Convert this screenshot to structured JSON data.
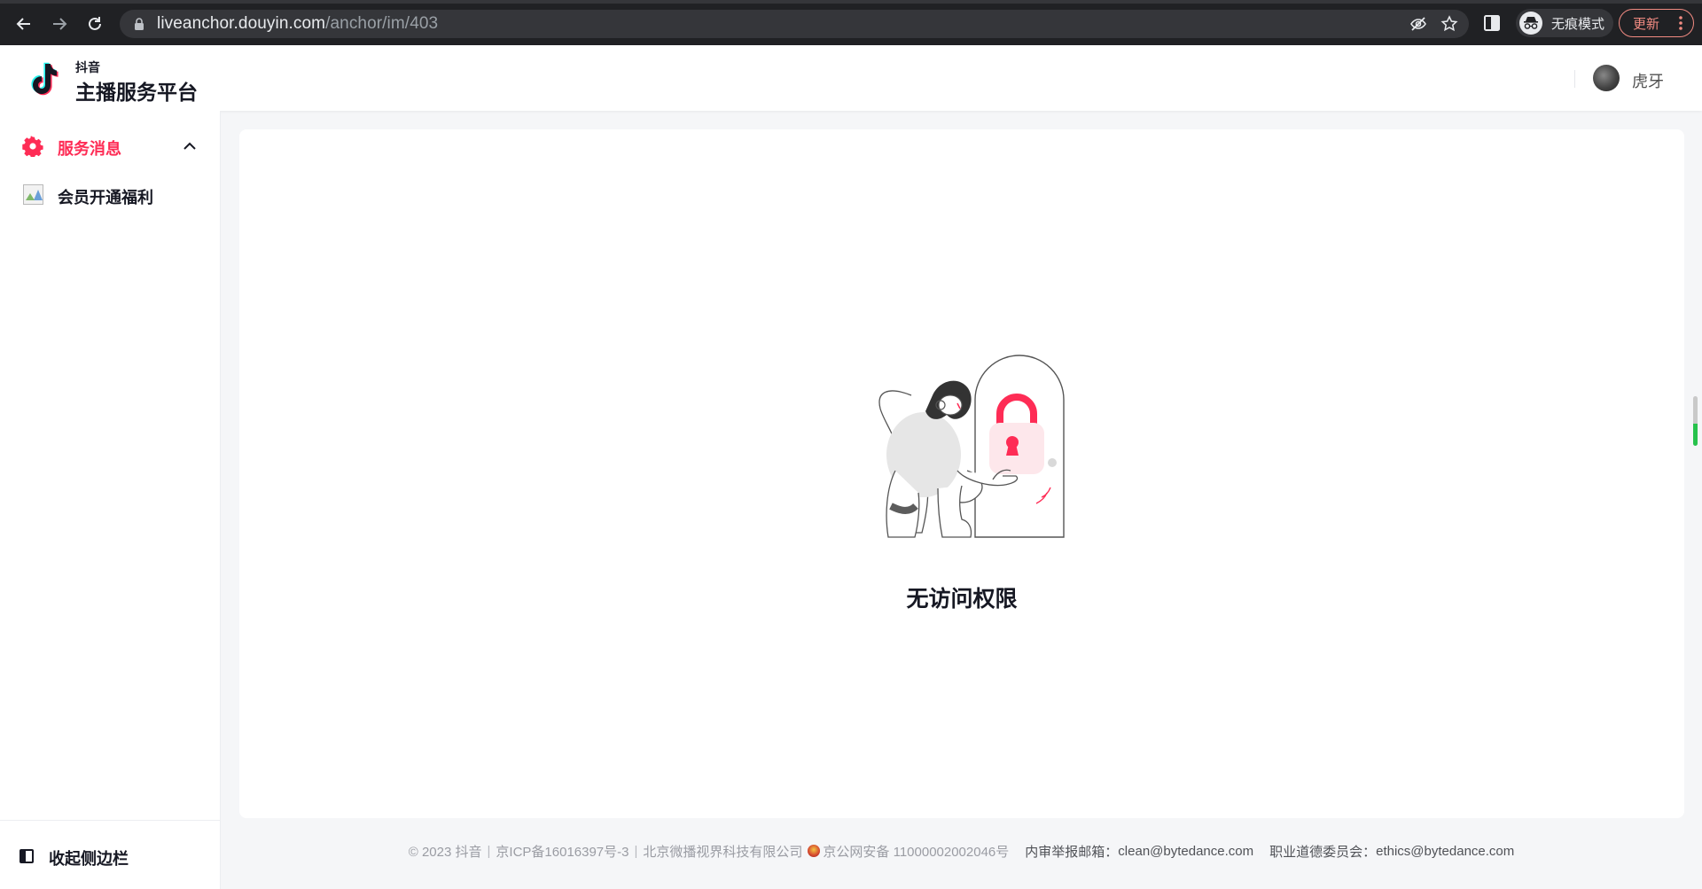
{
  "browser": {
    "url_host": "liveanchor.douyin.com",
    "url_path": "/anchor/im/403",
    "incognito_label": "无痕模式",
    "update_label": "更新"
  },
  "header": {
    "brand_small": "抖音",
    "brand_large": "主播服务平台",
    "username": "虎牙"
  },
  "sidebar": {
    "group_label": "服务消息",
    "items": [
      {
        "label": "会员开通福利"
      }
    ],
    "collapse_label": "收起侧边栏"
  },
  "main": {
    "empty_title": "无访问权限"
  },
  "footer": {
    "copyright": "© 2023 抖音",
    "icp": "京ICP备16016397号-3",
    "company": "北京微播视界科技有限公司",
    "police": "京公网安备 11000002002046号",
    "report_label": "内审举报邮箱：",
    "report_email": "clean@bytedance.com",
    "ethics_label": "职业道德委员会：",
    "ethics_email": "ethics@bytedance.com"
  },
  "colors": {
    "accent": "#fe2c55",
    "browser_bg": "#202124",
    "omnibox_bg": "#35363a",
    "page_bg": "#f5f6f8"
  }
}
